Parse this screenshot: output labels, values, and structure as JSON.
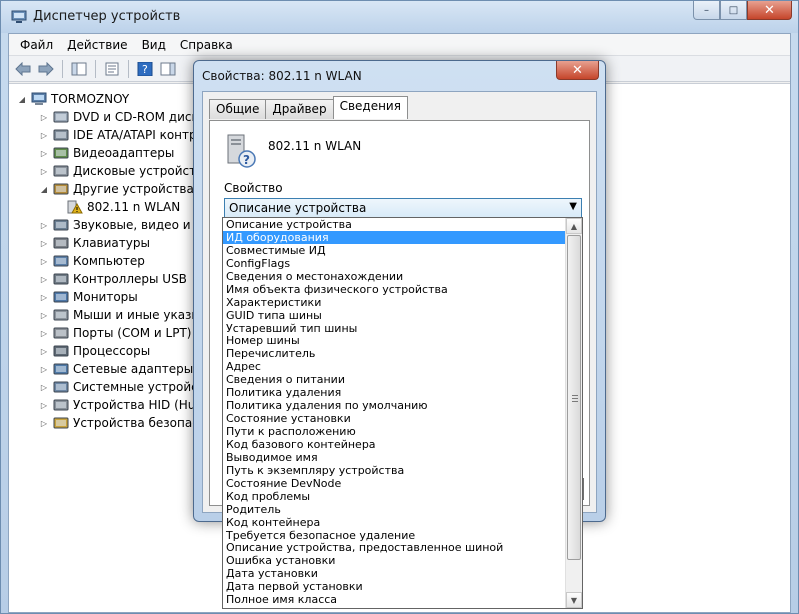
{
  "window": {
    "title": "Диспетчер устройств",
    "controls": {
      "minimize": "–",
      "maximize": "□",
      "close": "✕"
    }
  },
  "menu": [
    "Файл",
    "Действие",
    "Вид",
    "Справка"
  ],
  "toolbar_icons": [
    "back-arrow-icon",
    "forward-arrow-icon",
    "show-hide-console-tree-icon",
    "properties-icon",
    "help-icon",
    "show-hide-action-pane-icon"
  ],
  "tree": {
    "root": "TORMOZNOY",
    "items": [
      {
        "label": "DVD и CD-ROM дисково",
        "expander": "▷",
        "icon": "dvd-icon",
        "indent": 1
      },
      {
        "label": "IDE ATA/ATAPI контро",
        "expander": "▷",
        "icon": "ide-icon",
        "indent": 1
      },
      {
        "label": "Видеоадаптеры",
        "expander": "▷",
        "icon": "display-adapter-icon",
        "indent": 1
      },
      {
        "label": "Дисковые устройства",
        "expander": "▷",
        "icon": "disk-icon",
        "indent": 1
      },
      {
        "label": "Другие устройства",
        "expander": "◢",
        "icon": "other-devices-icon",
        "indent": 1
      },
      {
        "label": "802.11 n WLAN",
        "expander": "",
        "icon": "unknown-device-warning-icon",
        "indent": 2
      },
      {
        "label": "Звуковые, видео и игр",
        "expander": "▷",
        "icon": "sound-icon",
        "indent": 1
      },
      {
        "label": "Клавиатуры",
        "expander": "▷",
        "icon": "keyboard-icon",
        "indent": 1
      },
      {
        "label": "Компьютер",
        "expander": "▷",
        "icon": "computer-icon",
        "indent": 1
      },
      {
        "label": "Контроллеры USB",
        "expander": "▷",
        "icon": "usb-icon",
        "indent": 1
      },
      {
        "label": "Мониторы",
        "expander": "▷",
        "icon": "monitor-icon",
        "indent": 1
      },
      {
        "label": "Мыши и иные указыв",
        "expander": "▷",
        "icon": "mouse-icon",
        "indent": 1
      },
      {
        "label": "Порты (COM и LPT)",
        "expander": "▷",
        "icon": "port-icon",
        "indent": 1
      },
      {
        "label": "Процессоры",
        "expander": "▷",
        "icon": "processor-icon",
        "indent": 1
      },
      {
        "label": "Сетевые адаптеры",
        "expander": "▷",
        "icon": "network-adapter-icon",
        "indent": 1
      },
      {
        "label": "Системные устройств",
        "expander": "▷",
        "icon": "system-devices-icon",
        "indent": 1
      },
      {
        "label": "Устройства HID (Hum",
        "expander": "▷",
        "icon": "hid-icon",
        "indent": 1
      },
      {
        "label": "Устройства безопасн",
        "expander": "▷",
        "icon": "security-devices-icon",
        "indent": 1
      }
    ]
  },
  "dialog": {
    "title": "Свойства: 802.11 n WLAN",
    "close": "✕",
    "tabs": [
      {
        "label": "Общие",
        "active": false
      },
      {
        "label": "Драйвер",
        "active": false
      },
      {
        "label": "Сведения",
        "active": true
      }
    ],
    "device_name": "802.11 n WLAN",
    "property_label": "Свойство",
    "combo_value": "Описание устройства",
    "combo_arrow": "▼"
  },
  "dropdown": {
    "selected_index": 1,
    "scroll_up": "▲",
    "scroll_down": "▼",
    "items": [
      "Описание устройства",
      "ИД оборудования",
      "Совместимые ИД",
      "ConfigFlags",
      "Сведения о местонахождении",
      "Имя объекта физического устройства",
      "Характеристики",
      "GUID типа шины",
      "Устаревший тип шины",
      "Номер шины",
      "Перечислитель",
      "Адрес",
      "Сведения о питании",
      "Политика удаления",
      "Политика удаления по умолчанию",
      "Состояние установки",
      "Пути к расположению",
      "Код базового контейнера",
      "Выводимое имя",
      "Путь к экземпляру устройства",
      "Состояние DevNode",
      "Код проблемы",
      "Родитель",
      "Код контейнера",
      "Требуется безопасное удаление",
      "Описание устройства, предоставленное шиной",
      "Ошибка установки",
      "Дата установки",
      "Дата первой установки",
      "Полное имя класса"
    ]
  }
}
